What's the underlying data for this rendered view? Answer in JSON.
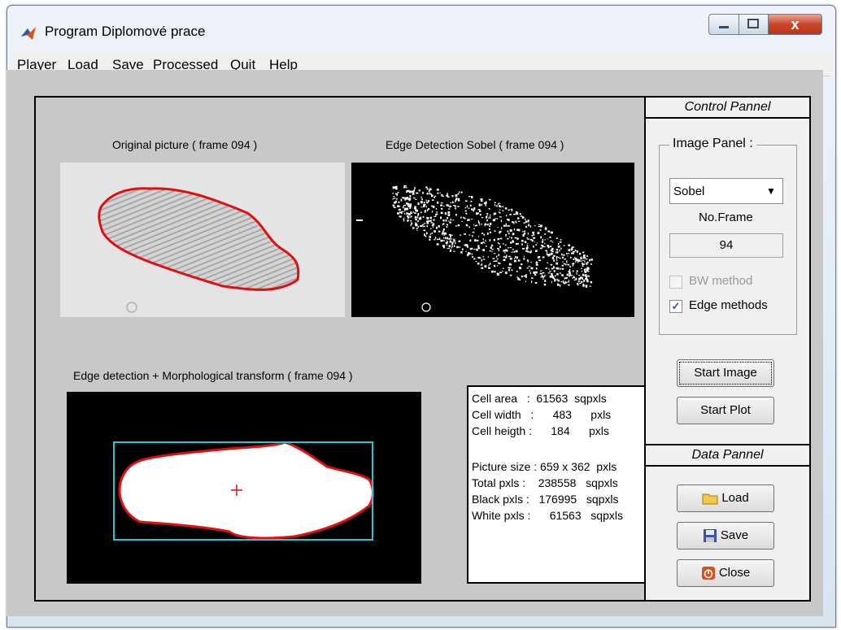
{
  "window": {
    "title": "Program Diplomové prace",
    "close_glyph": "x"
  },
  "menu": [
    "Player",
    "Load",
    "Save",
    "Processed",
    "Quit",
    "Help"
  ],
  "axes": {
    "original_title": "Original picture ( frame  094 )",
    "sobel_title": "Edge Detection Sobel ( frame  094 )",
    "morph_title": "Edge detection + Morphological transform ( frame  094 )"
  },
  "stats": [
    "Cell area   :  61563  sqpxls",
    "Cell width   :      483      pxls",
    "Cell heigth :      184      pxls",
    "",
    "Picture size : 659 x 362  pxls",
    "Total pxls :    238558   sqpxls",
    "Black pxls :   176995   sqpxls",
    "White pxls :      61563   sqpxls"
  ],
  "control_panel": {
    "header": "Control Pannel",
    "group_title": "Image Panel :",
    "method_select": {
      "value": "Sobel"
    },
    "frame_label": "No.Frame",
    "frame_value": "94",
    "bw_method": {
      "label": "BW method",
      "checked": false,
      "enabled": false
    },
    "edge_methods": {
      "label": "Edge methods",
      "checked": true
    },
    "start_image": "Start Image",
    "start_plot": "Start Plot"
  },
  "data_panel": {
    "header": "Data Pannel",
    "load": "Load",
    "save": "Save",
    "close": "Close"
  },
  "colors": {
    "contour": "#e01010",
    "bbox": "#20c8d8",
    "panel_bg": "#c8c8c8",
    "sidebar_bg": "#f0f0f0"
  },
  "icons": {
    "app": "matlab-icon",
    "load": "folder-icon",
    "save": "floppy-disk-icon",
    "close": "power-icon"
  }
}
